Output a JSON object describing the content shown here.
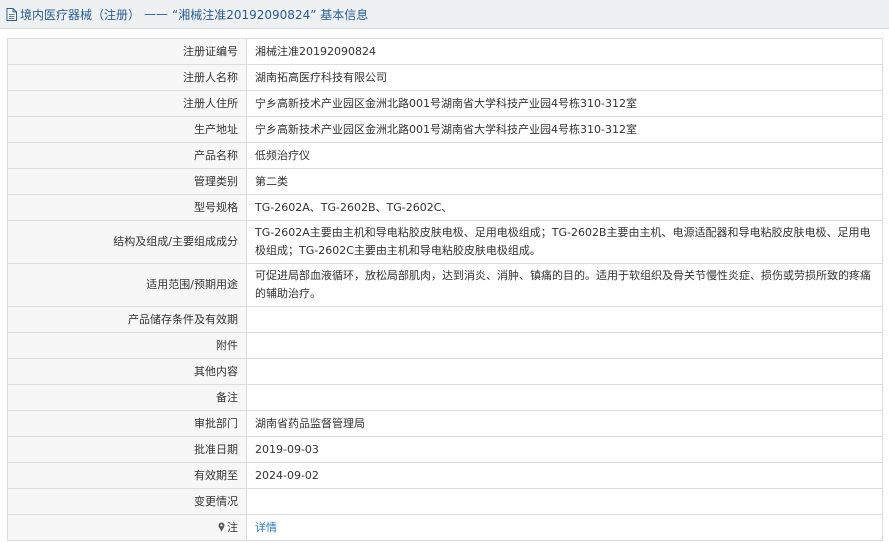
{
  "header": {
    "breadcrumb": "境内医疗器械（注册）",
    "separator": "——",
    "title": "“湘械注准20192090824” 基本信息"
  },
  "rows": [
    {
      "label": "注册证编号",
      "value": "湘械注准20192090824"
    },
    {
      "label": "注册人名称",
      "value": "湖南拓高医疗科技有限公司"
    },
    {
      "label": "注册人住所",
      "value": "宁乡高新技术产业园区金洲北路001号湖南省大学科技产业园4号栋310-312室"
    },
    {
      "label": "生产地址",
      "value": "宁乡高新技术产业园区金洲北路001号湖南省大学科技产业园4号栋310-312室"
    },
    {
      "label": "产品名称",
      "value": "低频治疗仪"
    },
    {
      "label": "管理类别",
      "value": "第二类"
    },
    {
      "label": "型号规格",
      "value": "TG-2602A、TG-2602B、TG-2602C、"
    },
    {
      "label": "结构及组成/主要组成成分",
      "value": "TG-2602A主要由主机和导电粘胶皮肤电极、足用电极组成；TG-2602B主要由主机、电源适配器和导电粘胶皮肤电极、足用电极组成；TG-2602C主要由主机和导电粘胶皮肤电极组成。"
    },
    {
      "label": "适用范围/预期用途",
      "value": "可促进局部血液循环，放松局部肌肉，达到消炎、消肿、镇痛的目的。适用于软组织及骨关节慢性炎症、损伤或劳损所致的疼痛的辅助治疗。"
    },
    {
      "label": "产品储存条件及有效期",
      "value": ""
    },
    {
      "label": "附件",
      "value": ""
    },
    {
      "label": "其他内容",
      "value": ""
    },
    {
      "label": "备注",
      "value": ""
    },
    {
      "label": "审批部门",
      "value": "湖南省药品监督管理局"
    },
    {
      "label": "批准日期",
      "value": "2019-09-03"
    },
    {
      "label": "有效期至",
      "value": "2024-09-02"
    },
    {
      "label": "变更情况",
      "value": ""
    }
  ],
  "note": {
    "label": "注",
    "link_text": "详情"
  },
  "colors": {
    "link": "#2a79c8",
    "header_text": "#2a5d97",
    "label_bg": "#f7f7f7",
    "border": "#dcdcdc"
  }
}
